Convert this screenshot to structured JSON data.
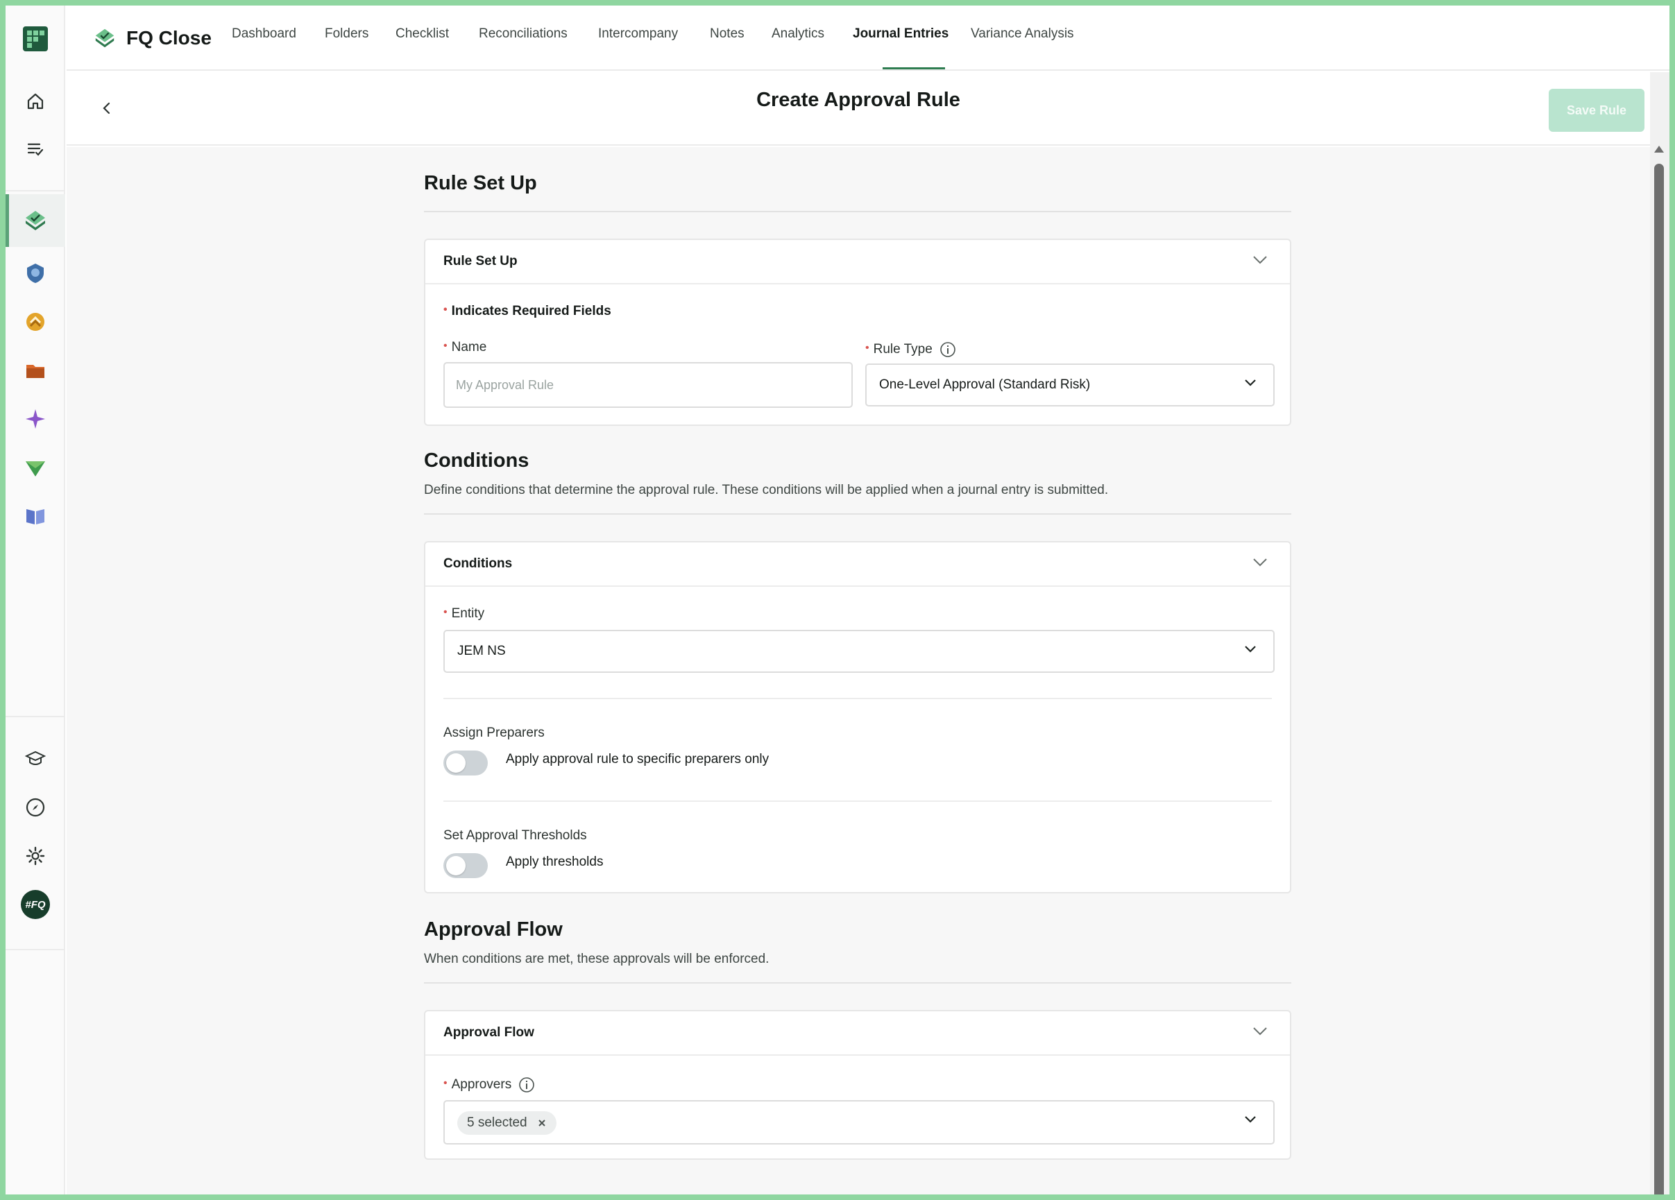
{
  "app": {
    "name": "FQ Close"
  },
  "nav": {
    "items": [
      "Dashboard",
      "Folders",
      "Checklist",
      "Reconciliations",
      "Intercompany",
      "Notes",
      "Analytics",
      "Journal Entries",
      "Variance Analysis"
    ],
    "active": "Journal Entries"
  },
  "rail": {
    "icons": [
      "app-logo-icon",
      "home-icon",
      "tasks-list-icon",
      "fq-close-icon",
      "shield-app-icon",
      "sync-app-icon",
      "folder-app-icon",
      "sparkle-app-icon",
      "paper-plane-app-icon",
      "book-app-icon",
      "graduation-cap-icon",
      "compass-icon",
      "gear-icon",
      "user-avatar"
    ],
    "avatar_text": "#FQ"
  },
  "header": {
    "title": "Create Approval Rule",
    "save_label": "Save Rule"
  },
  "rule_setup": {
    "section_title": "Rule Set Up",
    "card_title": "Rule Set Up",
    "required_note": "Indicates Required Fields",
    "name_label": "Name",
    "name_placeholder": "My Approval Rule",
    "rule_type_label": "Rule Type",
    "rule_type_value": "One-Level Approval (Standard Risk)"
  },
  "conditions": {
    "section_title": "Conditions",
    "description": "Define conditions that determine the approval rule. These conditions will be applied when a journal entry is submitted.",
    "card_title": "Conditions",
    "entity_label": "Entity",
    "entity_value": "JEM NS",
    "preparers_label": "Assign Preparers",
    "preparers_toggle_text": "Apply approval rule to specific preparers only",
    "preparers_toggle_on": false,
    "thresholds_label": "Set Approval Thresholds",
    "thresholds_toggle_text": "Apply thresholds",
    "thresholds_toggle_on": false
  },
  "approval_flow": {
    "section_title": "Approval Flow",
    "description": "When conditions are met, these approvals will be enforced.",
    "card_title": "Approval Flow",
    "approvers_label": "Approvers",
    "approvers_chip": "5 selected"
  },
  "colors": {
    "accent": "#2e7d50",
    "save_disabled": "#b9e4cf",
    "required": "#d9534f",
    "frame": "#8fd6a0"
  }
}
